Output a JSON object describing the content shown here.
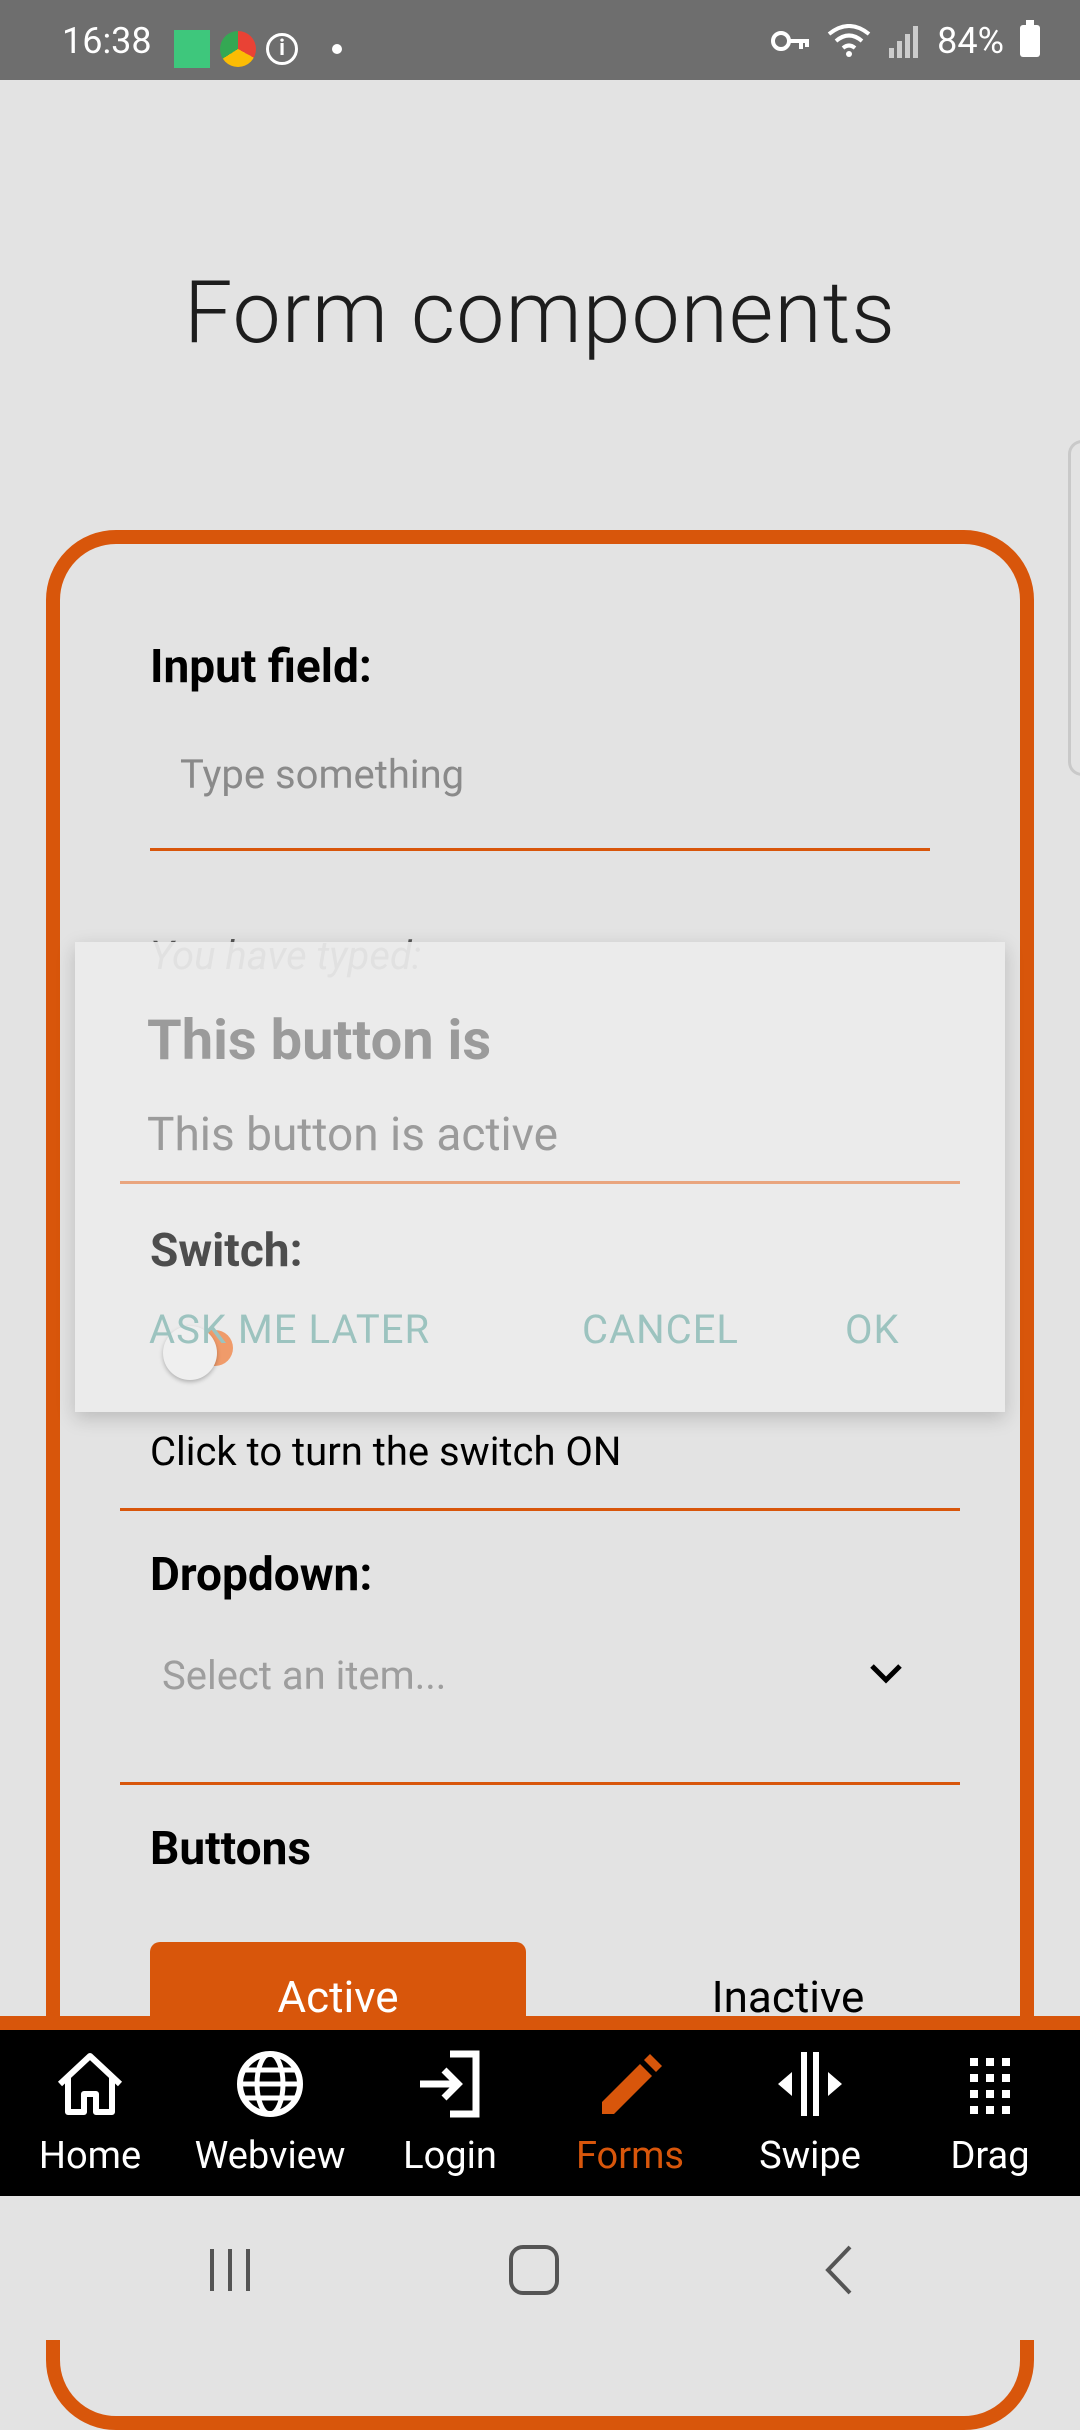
{
  "status_bar": {
    "time": "16:38",
    "battery": "84%"
  },
  "page": {
    "title": "Form components"
  },
  "form": {
    "input_label": "Input field:",
    "input_placeholder": "Type something",
    "typed_label": "You have typed:",
    "switch_hint": "Click to turn the switch ON",
    "dropdown_label": "Dropdown:",
    "dropdown_placeholder": "Select an item...",
    "buttons_label": "Buttons",
    "active_button": "Active",
    "inactive_button": "Inactive"
  },
  "dialog": {
    "title": "This button is",
    "message": "This button is active",
    "switch_label": "Switch:",
    "ask_later": "ASK ME LATER",
    "cancel": "CANCEL",
    "ok": "OK"
  },
  "tabs": [
    {
      "label": "Home",
      "icon": "home-icon"
    },
    {
      "label": "Webview",
      "icon": "globe-icon"
    },
    {
      "label": "Login",
      "icon": "login-icon"
    },
    {
      "label": "Forms",
      "icon": "pencil-icon",
      "active": true
    },
    {
      "label": "Swipe",
      "icon": "swipe-icon"
    },
    {
      "label": "Drag",
      "icon": "grid-icon"
    }
  ],
  "colors": {
    "accent": "#d8560b",
    "dialog_button": "#9cc3bf"
  }
}
